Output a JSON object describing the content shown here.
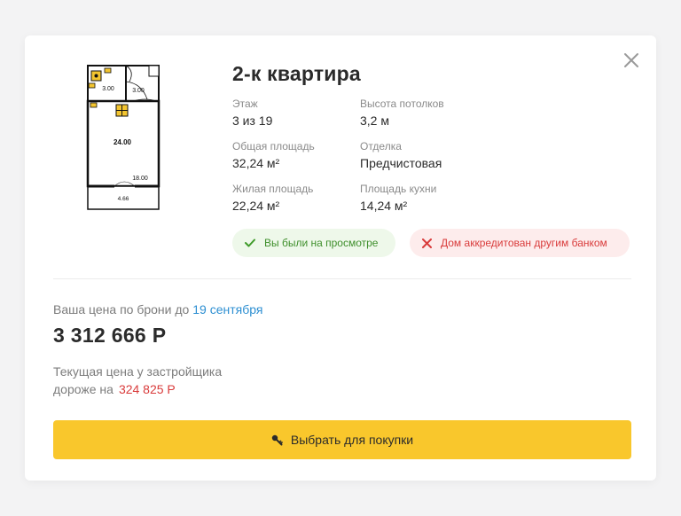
{
  "listing": {
    "title": "2-к квартира",
    "specs": {
      "floor_label": "Этаж",
      "floor_value": "3 из 19",
      "ceiling_label": "Высота потолков",
      "ceiling_value": "3,2 м",
      "total_area_label": "Общая площадь",
      "total_area_value": "32,24 м²",
      "finish_label": "Отделка",
      "finish_value": "Предчистовая",
      "living_area_label": "Жилая площадь",
      "living_area_value": "22,24 м²",
      "kitchen_area_label": "Площадь кухни",
      "kitchen_area_value": "14,24 м²"
    },
    "badges": {
      "viewed": "Вы были на просмотре",
      "bank": "Дом аккредитован другим банком"
    },
    "floor_plan": {
      "labels": {
        "bath": "3.00",
        "hall": "3.00",
        "main_room": "24.00",
        "kitchen": "18.00",
        "balcony": "4.66"
      }
    }
  },
  "pricing": {
    "reserve_text": "Ваша цена по брони до",
    "reserve_date": "19 сентября",
    "price": "3 312 666 Р",
    "developer_line1": "Текущая цена у застройщика",
    "developer_line2": "дороже на",
    "developer_diff": "324 825 Р"
  },
  "action": {
    "button_label": "Выбрать для покупки"
  },
  "colors": {
    "accent": "#f9c72c",
    "success": "#3f8f2c",
    "danger": "#d93b3b",
    "link": "#2d8fd2"
  },
  "icons": {
    "close": "close-icon",
    "check": "check-icon",
    "cross": "cross-icon",
    "key": "key-icon"
  }
}
